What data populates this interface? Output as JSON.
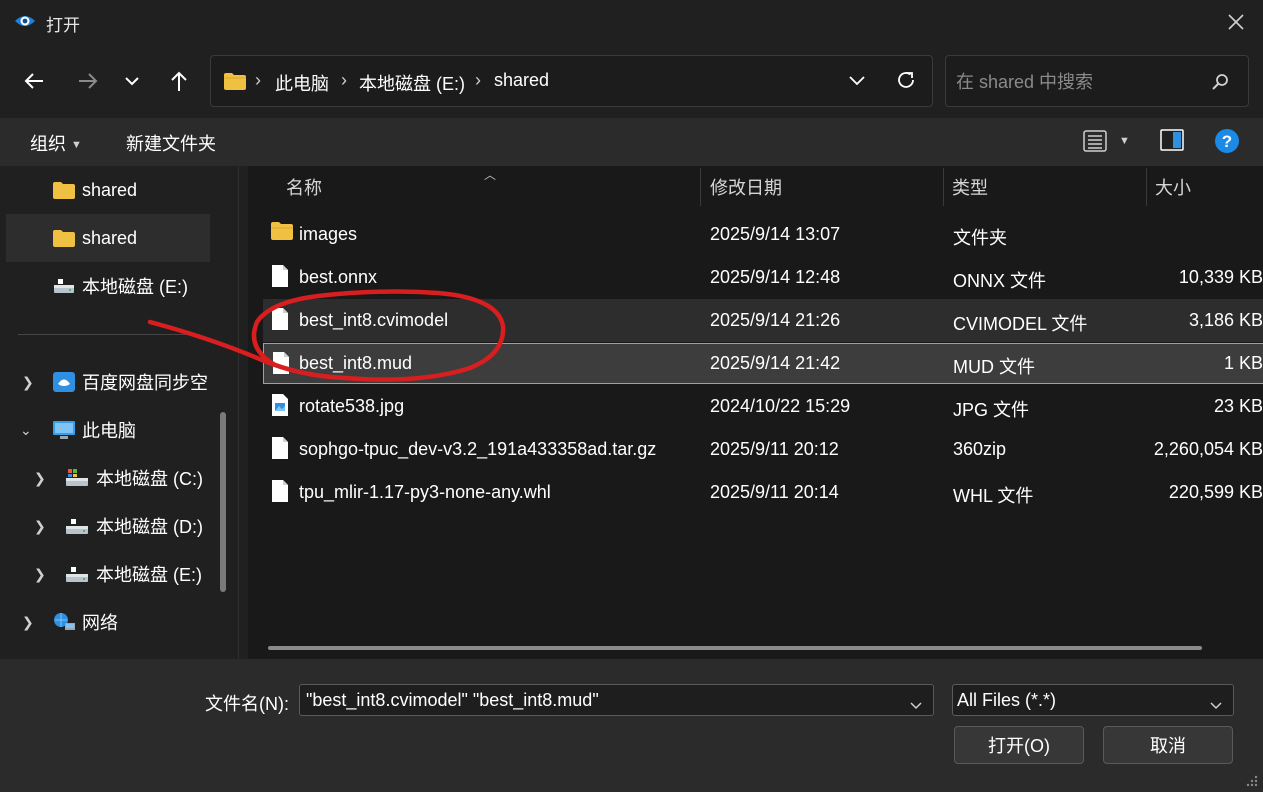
{
  "window": {
    "title": "打开",
    "close_icon": "close-icon"
  },
  "nav": {
    "back": "back-arrow-icon",
    "forward": "forward-arrow-icon",
    "recent": "chevron-down-icon",
    "up": "up-arrow-icon",
    "breadcrumbs": [
      "此电脑",
      "本地磁盘 (E:)",
      "shared"
    ],
    "refresh": "refresh-icon"
  },
  "search": {
    "placeholder": "在 shared 中搜索"
  },
  "toolbar": {
    "organize": "组织",
    "new_folder": "新建文件夹"
  },
  "sidebar": {
    "quick": [
      {
        "label": "shared",
        "icon": "folder-icon",
        "selected": false
      },
      {
        "label": "shared",
        "icon": "folder-icon",
        "selected": true
      },
      {
        "label": "本地磁盘 (E:)",
        "icon": "drive-icon",
        "selected": false
      }
    ],
    "tree": [
      {
        "label": "百度网盘同步空",
        "icon": "baidu-netdisk-icon",
        "expanded": false
      },
      {
        "label": "此电脑",
        "icon": "computer-icon",
        "expanded": true
      },
      {
        "label": "本地磁盘 (C:)",
        "icon": "drive-icon",
        "expanded": false
      },
      {
        "label": "本地磁盘 (D:)",
        "icon": "drive-icon",
        "expanded": false
      },
      {
        "label": "本地磁盘 (E:)",
        "icon": "drive-icon",
        "expanded": false
      },
      {
        "label": "网络",
        "icon": "network-icon",
        "expanded": false
      }
    ]
  },
  "files": {
    "columns": [
      "名称",
      "修改日期",
      "类型",
      "大小"
    ],
    "rows": [
      {
        "name": "images",
        "date": "2025/9/14 13:07",
        "type": "文件夹",
        "size": "",
        "icon": "folder-icon",
        "state": "normal"
      },
      {
        "name": "best.onnx",
        "date": "2025/9/14 12:48",
        "type": "ONNX 文件",
        "size": "10,339 KB",
        "icon": "file-icon",
        "state": "normal"
      },
      {
        "name": "best_int8.cvimodel",
        "date": "2025/9/14 21:26",
        "type": "CVIMODEL 文件",
        "size": "3,186 KB",
        "icon": "file-icon",
        "state": "hover"
      },
      {
        "name": "best_int8.mud",
        "date": "2025/9/14 21:42",
        "type": "MUD 文件",
        "size": "1 KB",
        "icon": "file-icon",
        "state": "selected"
      },
      {
        "name": "rotate538.jpg",
        "date": "2024/10/22 15:29",
        "type": "JPG 文件",
        "size": "23 KB",
        "icon": "image-file-icon",
        "state": "normal"
      },
      {
        "name": "sophgo-tpuc_dev-v3.2_191a433358ad.tar.gz",
        "date": "2025/9/11 20:12",
        "type": "360zip",
        "size": "2,260,054 KB",
        "icon": "file-icon",
        "state": "normal"
      },
      {
        "name": "tpu_mlir-1.17-py3-none-any.whl",
        "date": "2025/9/11 20:14",
        "type": "WHL 文件",
        "size": "220,599 KB",
        "icon": "file-icon",
        "state": "normal"
      }
    ]
  },
  "footer": {
    "filename_label": "文件名(N):",
    "filename_value": "\"best_int8.cvimodel\" \"best_int8.mud\"",
    "filetype_value": "All Files (*.*)",
    "open_button": "打开(O)",
    "cancel_button": "取消"
  },
  "colors": {
    "background": "#202020",
    "accent": "#1a8ae6",
    "annotation": "#d81e1e",
    "folder": "#f0c042"
  }
}
